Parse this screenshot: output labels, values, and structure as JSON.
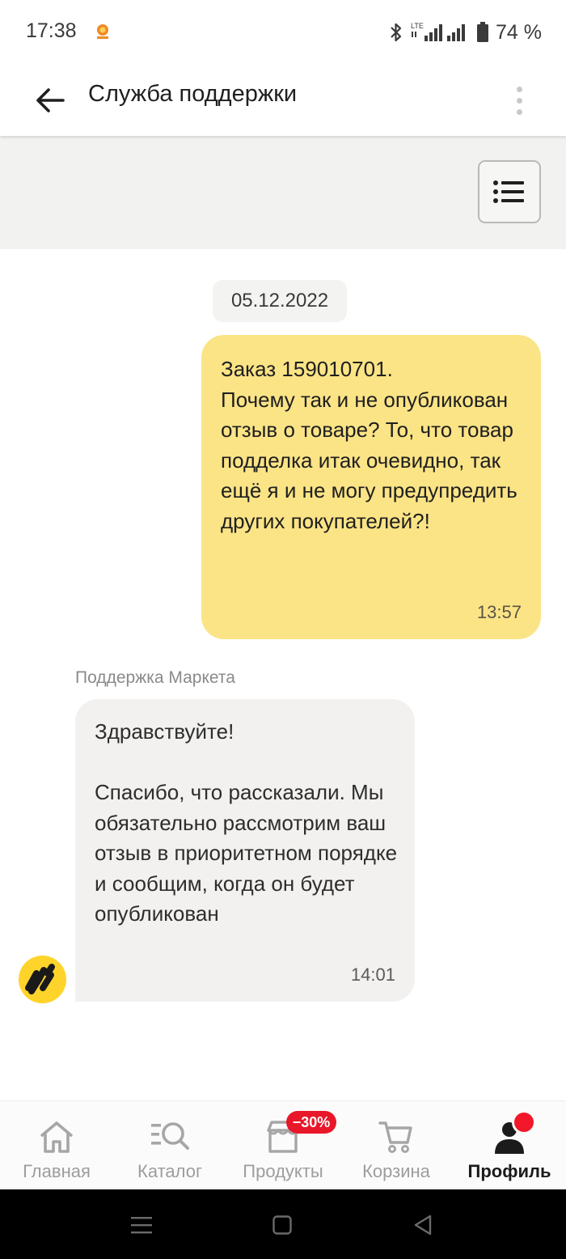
{
  "status_bar": {
    "time": "17:38",
    "network": "LTE",
    "battery": "74 %"
  },
  "header": {
    "title": "Служба поддержки"
  },
  "chat": {
    "date": "05.12.2022",
    "messages": [
      {
        "direction": "outgoing",
        "text": "Заказ 159010701.\nПочему так и не опубликован отзыв о товаре? То, что товар подделка итак очевидно, так ещё я и не могу предупредить других покупателей?!",
        "time": "13:57"
      },
      {
        "direction": "incoming",
        "sender": "Поддержка Маркета",
        "text": "Здравствуйте!\n\nСпасибо, что рассказали. Мы обязательно рассмотрим ваш отзыв в приоритетном порядке и сообщим, когда он будет опубликован",
        "time": "14:01"
      }
    ]
  },
  "bottom_nav": {
    "items": [
      {
        "label": "Главная",
        "icon": "home-icon"
      },
      {
        "label": "Каталог",
        "icon": "catalog-search-icon"
      },
      {
        "label": "Продукты",
        "icon": "store-icon",
        "badge": "−30%"
      },
      {
        "label": "Корзина",
        "icon": "cart-icon"
      },
      {
        "label": "Профиль",
        "icon": "profile-icon",
        "active": true
      }
    ]
  },
  "colors": {
    "outgoing_bubble": "#fbe486",
    "incoming_bubble": "#f2f1ef",
    "badge": "#e8172a",
    "brand_yellow": "#fed42b"
  }
}
